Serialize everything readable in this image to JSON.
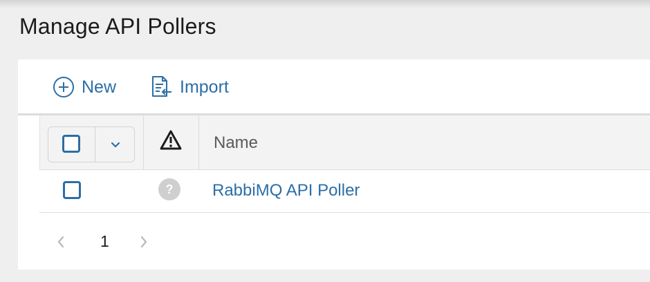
{
  "page": {
    "title": "Manage API Pollers"
  },
  "toolbar": {
    "new_label": "New",
    "import_label": "Import"
  },
  "table": {
    "columns": {
      "status_icon": "warning-icon",
      "name": "Name"
    },
    "rows": [
      {
        "status_icon": "question-icon",
        "status_glyph": "?",
        "name": "RabbiMQ API Poller",
        "selected": false
      }
    ]
  },
  "pagination": {
    "current_page": "1"
  },
  "colors": {
    "accent": "#2b6ea6",
    "background": "#efefef",
    "panel": "#ffffff",
    "header_text": "#5a5a5a"
  }
}
